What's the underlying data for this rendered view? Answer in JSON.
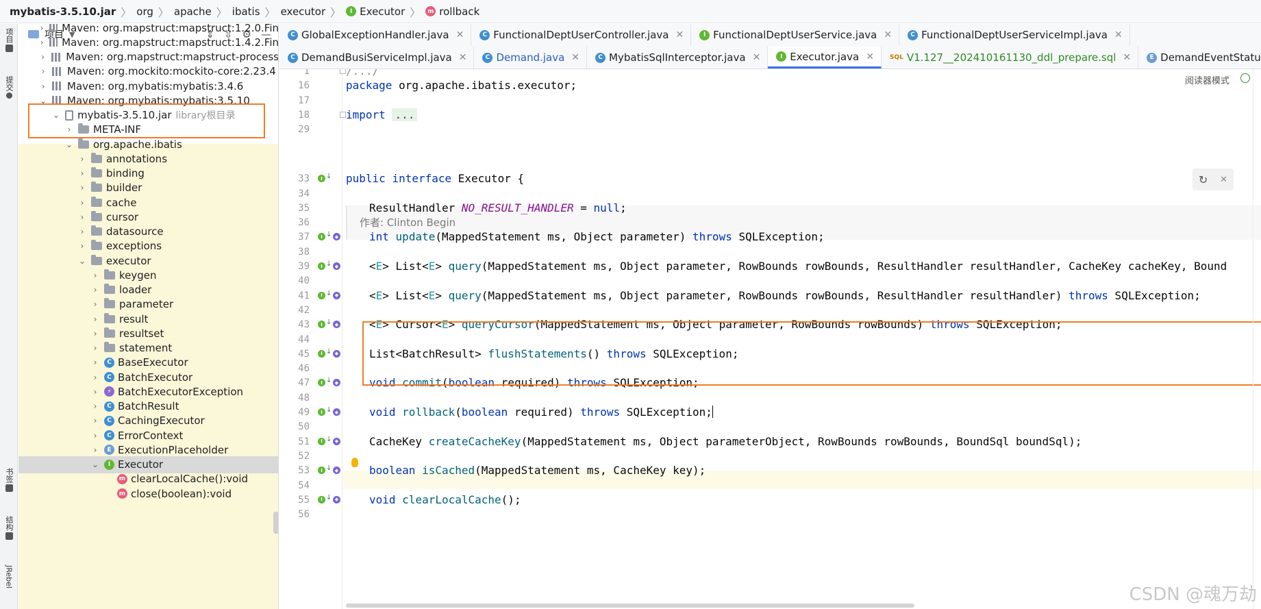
{
  "breadcrumb": {
    "items": [
      "mybatis-3.5.10.jar",
      "org",
      "apache",
      "ibatis",
      "executor",
      "Executor",
      "rollback"
    ],
    "executor_icon": "interface-icon",
    "rollback_icon": "method-icon"
  },
  "left_strip": {
    "items": [
      "项目",
      "提交",
      "书签",
      "结构",
      "JRebel"
    ]
  },
  "project_panel": {
    "title": "项目",
    "tree": [
      {
        "label": "Maven: org.mapstruct:mapstruct:1.2.0.Fin",
        "kind": "library",
        "expanded": false
      },
      {
        "label": "Maven: org.mapstruct:mapstruct:1.4.2.Fin",
        "kind": "library",
        "expanded": false
      },
      {
        "label": "Maven: org.mapstruct:mapstruct-process",
        "kind": "library",
        "expanded": false
      },
      {
        "label": "Maven: org.mockito:mockito-core:2.23.4",
        "kind": "library",
        "expanded": false
      },
      {
        "label": "Maven: org.mybatis:mybatis:3.4.6",
        "kind": "library",
        "expanded": false
      },
      {
        "label": "Maven: org.mybatis:mybatis:3.5.10",
        "kind": "library",
        "expanded": true
      },
      {
        "label": "mybatis-3.5.10.jar",
        "suffix": "library根目录",
        "kind": "jar",
        "expanded": true
      },
      {
        "label": "META-INF",
        "kind": "folder",
        "expanded": false
      },
      {
        "label": "org.apache.ibatis",
        "kind": "folder",
        "expanded": true
      },
      {
        "label": "annotations",
        "kind": "folder",
        "expanded": false
      },
      {
        "label": "binding",
        "kind": "folder",
        "expanded": false
      },
      {
        "label": "builder",
        "kind": "folder",
        "expanded": false
      },
      {
        "label": "cache",
        "kind": "folder",
        "expanded": false
      },
      {
        "label": "cursor",
        "kind": "folder",
        "expanded": false
      },
      {
        "label": "datasource",
        "kind": "folder",
        "expanded": false
      },
      {
        "label": "exceptions",
        "kind": "folder",
        "expanded": false
      },
      {
        "label": "executor",
        "kind": "folder",
        "expanded": true
      },
      {
        "label": "keygen",
        "kind": "folder",
        "expanded": false
      },
      {
        "label": "loader",
        "kind": "folder",
        "expanded": false
      },
      {
        "label": "parameter",
        "kind": "folder",
        "expanded": false
      },
      {
        "label": "result",
        "kind": "folder",
        "expanded": false
      },
      {
        "label": "resultset",
        "kind": "folder",
        "expanded": false
      },
      {
        "label": "statement",
        "kind": "folder",
        "expanded": false
      },
      {
        "label": "BaseExecutor",
        "kind": "class",
        "expanded": false
      },
      {
        "label": "BatchExecutor",
        "kind": "class",
        "expanded": false
      },
      {
        "label": "BatchExecutorException",
        "kind": "exception",
        "expanded": false
      },
      {
        "label": "BatchResult",
        "kind": "class",
        "expanded": false
      },
      {
        "label": "CachingExecutor",
        "kind": "class",
        "expanded": false
      },
      {
        "label": "ErrorContext",
        "kind": "class",
        "expanded": false
      },
      {
        "label": "ExecutionPlaceholder",
        "kind": "enum",
        "expanded": false
      },
      {
        "label": "Executor",
        "kind": "interface",
        "expanded": true,
        "selected": true
      },
      {
        "label": "clearLocalCache():void",
        "kind": "method"
      },
      {
        "label": "close(boolean):void",
        "kind": "method"
      }
    ]
  },
  "tabs": {
    "row1": [
      {
        "label": "GlobalExceptionHandler.java",
        "icon": "C"
      },
      {
        "label": "FunctionalDeptUserController.java",
        "icon": "C"
      },
      {
        "label": "FunctionalDeptUserService.java",
        "icon": "I"
      },
      {
        "label": "FunctionalDeptUserServiceImpl.java",
        "icon": "C"
      }
    ],
    "row2": [
      {
        "label": "DemandBusiServiceImpl.java",
        "icon": "C"
      },
      {
        "label": "Demand.java",
        "icon": "C"
      },
      {
        "label": "MybatisSqlInterceptor.java",
        "icon": "C"
      },
      {
        "label": "Executor.java",
        "icon": "I",
        "active": true
      },
      {
        "label": "V1.127__202410161130_ddl_prepare.sql",
        "icon": "SQL"
      },
      {
        "label": "DemandEventStatus.java",
        "icon": "E"
      }
    ]
  },
  "editor": {
    "reader_mode": "阅读器模式",
    "author": "作者: Clinton Begin",
    "watermark": "CSDN @魂万劫",
    "lines": [
      {
        "n": "1",
        "text": "/.../"
      },
      {
        "n": "16",
        "text": "package org.apache.ibatis.executor;"
      },
      {
        "n": "17",
        "text": ""
      },
      {
        "n": "18",
        "text": "import ..."
      },
      {
        "n": "29",
        "text": ""
      },
      {
        "n": "33",
        "text": "public interface Executor {"
      },
      {
        "n": "34",
        "text": ""
      },
      {
        "n": "35",
        "text": "ResultHandler NO_RESULT_HANDLER = null;"
      },
      {
        "n": "36",
        "text": ""
      },
      {
        "n": "37",
        "text": "int update(MappedStatement ms, Object parameter) throws SQLException;"
      },
      {
        "n": "38",
        "text": ""
      },
      {
        "n": "39",
        "text": "<E> List<E> query(MappedStatement ms, Object parameter, RowBounds rowBounds, ResultHandler resultHandler, CacheKey cacheKey, Bound"
      },
      {
        "n": "40",
        "text": ""
      },
      {
        "n": "41",
        "text": "<E> List<E> query(MappedStatement ms, Object parameter, RowBounds rowBounds, ResultHandler resultHandler) throws SQLException;"
      },
      {
        "n": "42",
        "text": ""
      },
      {
        "n": "43",
        "text": "<E> Cursor<E> queryCursor(MappedStatement ms, Object parameter, RowBounds rowBounds) throws SQLException;"
      },
      {
        "n": "44",
        "text": ""
      },
      {
        "n": "45",
        "text": "List<BatchResult> flushStatements() throws SQLException;"
      },
      {
        "n": "46",
        "text": ""
      },
      {
        "n": "47",
        "text": "void commit(boolean required) throws SQLException;"
      },
      {
        "n": "48",
        "text": ""
      },
      {
        "n": "49",
        "text": "void rollback(boolean required) throws SQLException;"
      },
      {
        "n": "50",
        "text": ""
      },
      {
        "n": "51",
        "text": "CacheKey createCacheKey(MappedStatement ms, Object parameterObject, RowBounds rowBounds, BoundSql boundSql);"
      },
      {
        "n": "52",
        "text": ""
      },
      {
        "n": "53",
        "text": "boolean isCached(MappedStatement ms, CacheKey key);"
      },
      {
        "n": "54",
        "text": ""
      },
      {
        "n": "55",
        "text": "void clearLocalCache();"
      },
      {
        "n": "56",
        "text": ""
      }
    ]
  },
  "colors": {
    "highlight_box": "#f07c27",
    "keyword": "#0033b3",
    "method": "#00627a",
    "constant": "#871094",
    "active_tab": "#3574f0"
  }
}
